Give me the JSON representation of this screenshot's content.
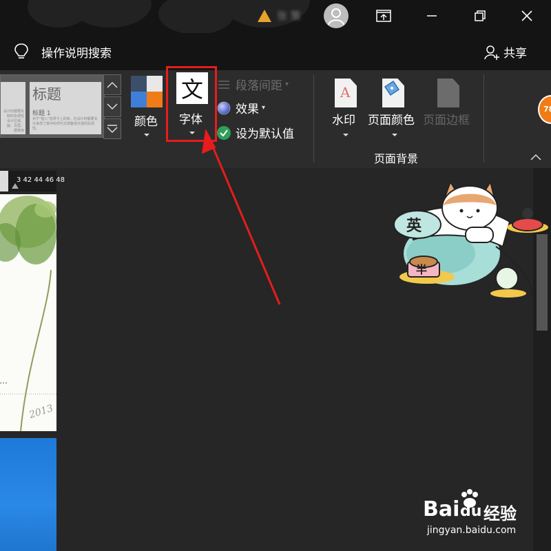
{
  "titlebar": {
    "user_name": "张 策",
    "window_controls": [
      "ribbon-display-icon",
      "minimize-icon",
      "restore-icon",
      "close-icon"
    ]
  },
  "tellme": {
    "search_label": "操作说明搜索",
    "share_label": "共享"
  },
  "ribbon": {
    "style_gallery": {
      "title_text": "标题",
      "heading_text": "标题 1",
      "body_lines_a": [
        "设计时都要充",
        "制的协调性",
        "设计区域、",
        "面、页眉、",
        "据表库"
      ],
      "body_lines_b": [
        "对于\"插入\"选项卡上的库，在设计时都要充分考虑了其中的项与文档整体外观的协调性。"
      ]
    },
    "colors_label": "颜色",
    "fonts_label": "字体",
    "fonts_icon_char": "文",
    "paragraph_spacing_label": "段落间距",
    "effects_label": "效果",
    "set_default_label": "设为默认值",
    "watermark_label": "水印",
    "page_color_label": "页面颜色",
    "page_border_label": "页面边框",
    "group_label": "页面背景",
    "badge_text": "78"
  },
  "document": {
    "ruler_text": "3   42 44 46 48",
    "page_year": "2013"
  },
  "sticker": {
    "char_top": "英",
    "char_bottom": "半"
  },
  "watermark": {
    "brand": "Bai",
    "brand_mid": "du",
    "brand_cn": "经验",
    "url": "jingyan.baidu.com"
  },
  "colors": {
    "highlight_red": "#e81c1c",
    "accent_orange": "#f07b17",
    "titlebar_bg": "#141414",
    "ribbon_bg": "#2c2c2c",
    "canvas_bg": "#262626"
  }
}
